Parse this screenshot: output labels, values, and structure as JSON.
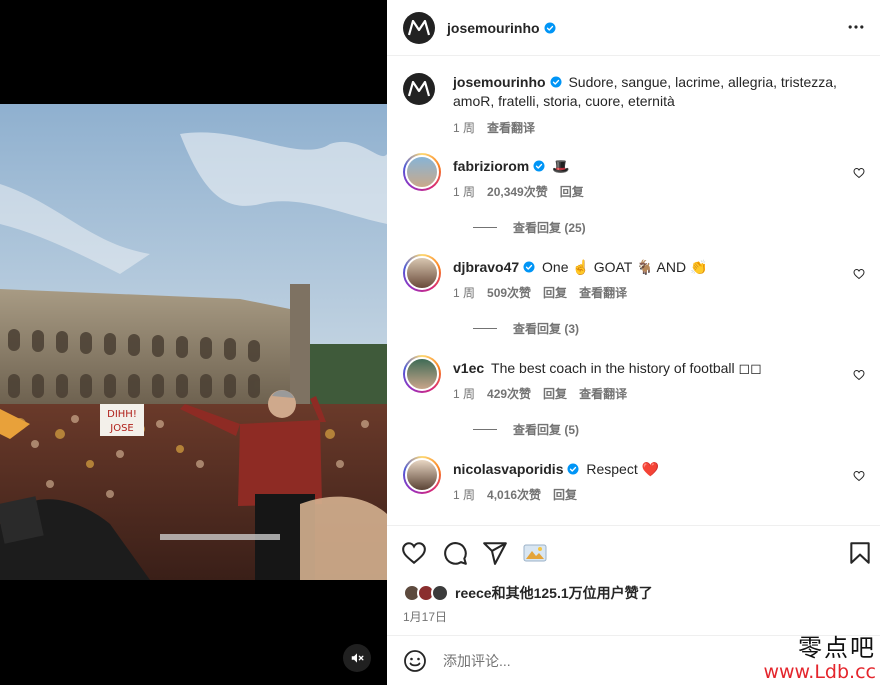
{
  "post": {
    "author": "josemourinho",
    "caption": "Sudore, sangue, lacrime, allegria, tristezza, amoR, fratelli, storia, cuore, eternità",
    "caption_time": "1 周",
    "caption_translate": "查看翻译"
  },
  "media": {
    "banner_text_line1": "DIHH!",
    "banner_text_line2": "JOSE",
    "mute_icon": "speaker-muted-icon"
  },
  "comments": [
    {
      "username": "fabriziorom",
      "verified": true,
      "text": "🎩",
      "time": "1 周",
      "likes": "20,349次赞",
      "reply": "回复",
      "translate": "",
      "view_replies": "查看回复 (25)"
    },
    {
      "username": "djbravo47",
      "verified": true,
      "text": "One ☝️ GOAT 🐐 AND 👏",
      "time": "1 周",
      "likes": "509次赞",
      "reply": "回复",
      "translate": "查看翻译",
      "view_replies": "查看回复 (3)"
    },
    {
      "username": "v1ec",
      "verified": false,
      "text": "The best coach in the history of football ◻◻",
      "time": "1 周",
      "likes": "429次赞",
      "reply": "回复",
      "translate": "查看翻译",
      "view_replies": "查看回复 (5)"
    },
    {
      "username": "nicolasvaporidis",
      "verified": true,
      "text": "Respect ❤️",
      "time": "1 周",
      "likes": "4,016次赞",
      "reply": "回复",
      "translate": "",
      "view_replies": ""
    }
  ],
  "actions": {
    "like_icon": "heart-icon",
    "comment_icon": "comment-icon",
    "share_icon": "send-icon",
    "save_icon": "bookmark-icon",
    "likes_text": "reece和其他125.1万位用户赞了",
    "date": "1月17日"
  },
  "add_comment": {
    "placeholder": "添加评论..."
  },
  "watermark": {
    "line1": "零点吧",
    "line2": "www.Ldb.cc"
  },
  "colors": {
    "verified": "#0095f6",
    "heart_red": "#ed4956",
    "secondary_text": "#737373"
  }
}
